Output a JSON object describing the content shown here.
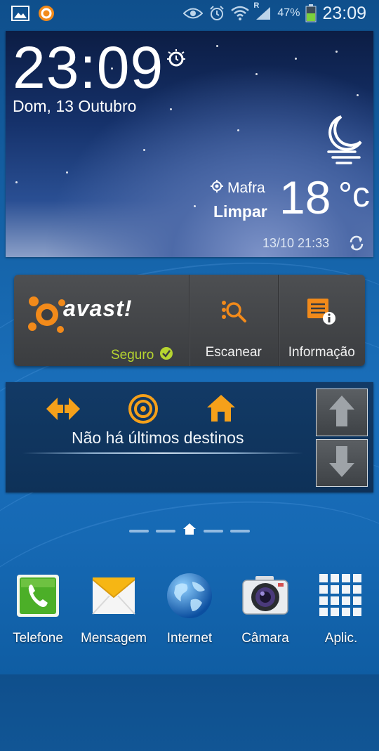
{
  "status_bar": {
    "battery_percent": "47%",
    "time": "23:09",
    "signal_roaming": "R",
    "icons": [
      "gallery-icon",
      "orange-circle-icon",
      "eye-icon",
      "alarm-icon",
      "wifi-icon",
      "signal-icon",
      "battery-icon"
    ]
  },
  "weather_widget": {
    "time": "23:09",
    "date": "Dom, 13 Outubro",
    "location": "Mafra",
    "condition": "Limpar",
    "temperature": "18",
    "unit": "°c",
    "updated": "13/10 21:33"
  },
  "avast_widget": {
    "brand": "avast!",
    "status": "Seguro",
    "scan_label": "Escanear",
    "info_label": "Informação",
    "colors": {
      "brand_orange": "#f28a1a",
      "status_green": "#b6d430"
    }
  },
  "nav_widget": {
    "message": "Não há últimos destinos"
  },
  "home_pager": {
    "pages": 5,
    "current": 2
  },
  "dock": {
    "apps": [
      {
        "label": "Telefone",
        "icon": "phone-icon"
      },
      {
        "label": "Mensagem",
        "icon": "envelope-icon"
      },
      {
        "label": "Internet",
        "icon": "globe-icon"
      },
      {
        "label": "Câmara",
        "icon": "camera-icon"
      },
      {
        "label": "Aplic.",
        "icon": "apps-grid-icon"
      }
    ]
  }
}
